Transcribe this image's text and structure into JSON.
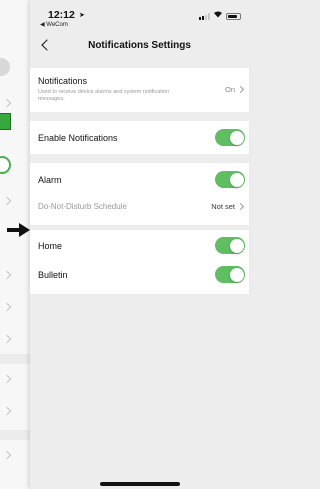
{
  "status_bar": {
    "time": "12:12",
    "back_app": "◀ WeCom"
  },
  "nav": {
    "title": "Notifications Settings"
  },
  "notifications_row": {
    "label": "Notifications",
    "description": "Used to receive device alarms and system notification messages.",
    "value": "On"
  },
  "enable_row": {
    "label": "Enable Notifications",
    "enabled": true
  },
  "alarm_row": {
    "label": "Alarm",
    "enabled": true
  },
  "dnd_row": {
    "label": "Do-Not-Disturb Schedule",
    "value": "Not set"
  },
  "home_row": {
    "label": "Home",
    "enabled": true
  },
  "bulletin_row": {
    "label": "Bulletin",
    "enabled": true
  },
  "colors": {
    "toggle_on": "#5fbd62",
    "background": "#ededed",
    "annotation_arrow": "#111111"
  },
  "icons": [
    "location-arrow-icon",
    "cellular-signal-icon",
    "wifi-icon",
    "battery-icon",
    "back-chevron-icon",
    "chevron-right-icon",
    "pointer-arrow-icon"
  ]
}
